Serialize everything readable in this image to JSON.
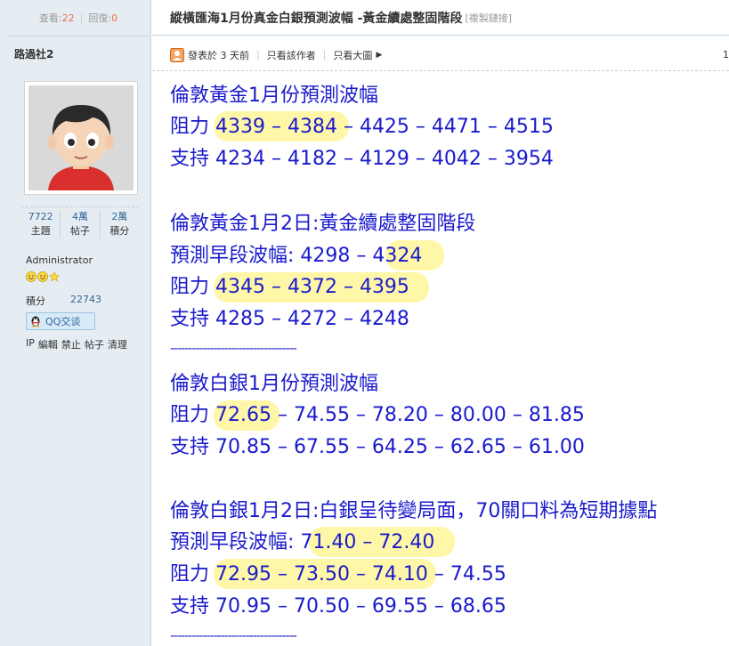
{
  "sidebar": {
    "views_label": "查看:",
    "views": "22",
    "replies_label": "回復:",
    "replies": "0",
    "author": "路過社2",
    "stats": [
      {
        "value": "7722",
        "label": "主題"
      },
      {
        "value": "4萬",
        "label": "帖子"
      },
      {
        "value": "2萬",
        "label": "積分"
      }
    ],
    "group": "Administrator",
    "points_label": "積分",
    "points": "22743",
    "qq_label": "QQ交谈",
    "admin_links": [
      "IP",
      "編輯",
      "禁止",
      "帖子",
      "清理"
    ]
  },
  "thread": {
    "title": "縱橫匯海1月份真金白銀預測波幅 -黃金續處整固階段",
    "copy_link": "[複製鏈接]"
  },
  "post_info": {
    "posted": "發表於 3 天前",
    "author_only": "只看該作者",
    "large_image": "只看大圖",
    "floor": "1"
  },
  "post": {
    "lines": [
      "倫敦黃金1月份預測波幅",
      "阻力 4339 – 4384 – 4425 – 4471 – 4515",
      "支持 4234 – 4182 – 4129 – 4042 – 3954",
      "倫敦黃金1月2日:黃金續處整固階段",
      "預測早段波幅:  4298 – 4324",
      "阻力 4345 – 4372 – 4395",
      "支持 4285 – 4272 – 4248",
      "倫敦白銀1月份預測波幅",
      "阻力 72.65 – 74.55 – 78.20 – 80.00 – 81.85",
      "支持 70.85 – 67.55 – 64.25 – 62.65 – 61.00",
      "倫敦白銀1月2日:白銀呈待變局面，70關口料為短期據點",
      "預測早段波幅:  71.40 – 72.40",
      "阻力 72.95 – 73.50 – 74.10 – 74.55",
      "支持 70.95 – 70.50 – 69.55 – 68.65"
    ],
    "divider1": "-----------------------------------",
    "divider2": "-----------------------------------"
  },
  "colors": {
    "text_blue": "#1a1acc",
    "highlight": "#fff7a8",
    "sidebar_bg": "#e5edf2",
    "accent_red": "#f26c4f"
  }
}
